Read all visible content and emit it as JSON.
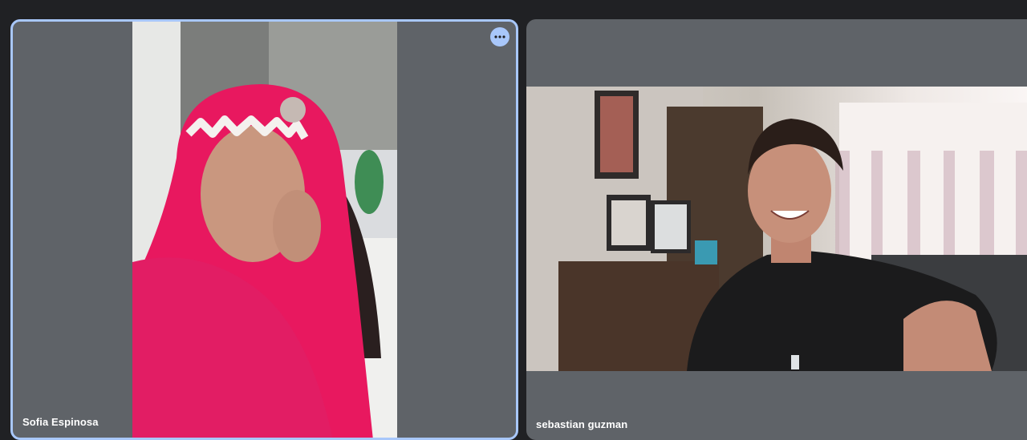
{
  "participants": [
    {
      "name": "Sofia Espinosa",
      "video_description": "selfie video feed",
      "more_options_icon": "more-horizontal-icon"
    },
    {
      "name": "sebastian guzman",
      "video_description": "webcam video feed"
    }
  ],
  "colors": {
    "background": "#202124",
    "tile": "#5f6368",
    "active_border": "#a8c7fa",
    "name_text": "#ffffff"
  }
}
